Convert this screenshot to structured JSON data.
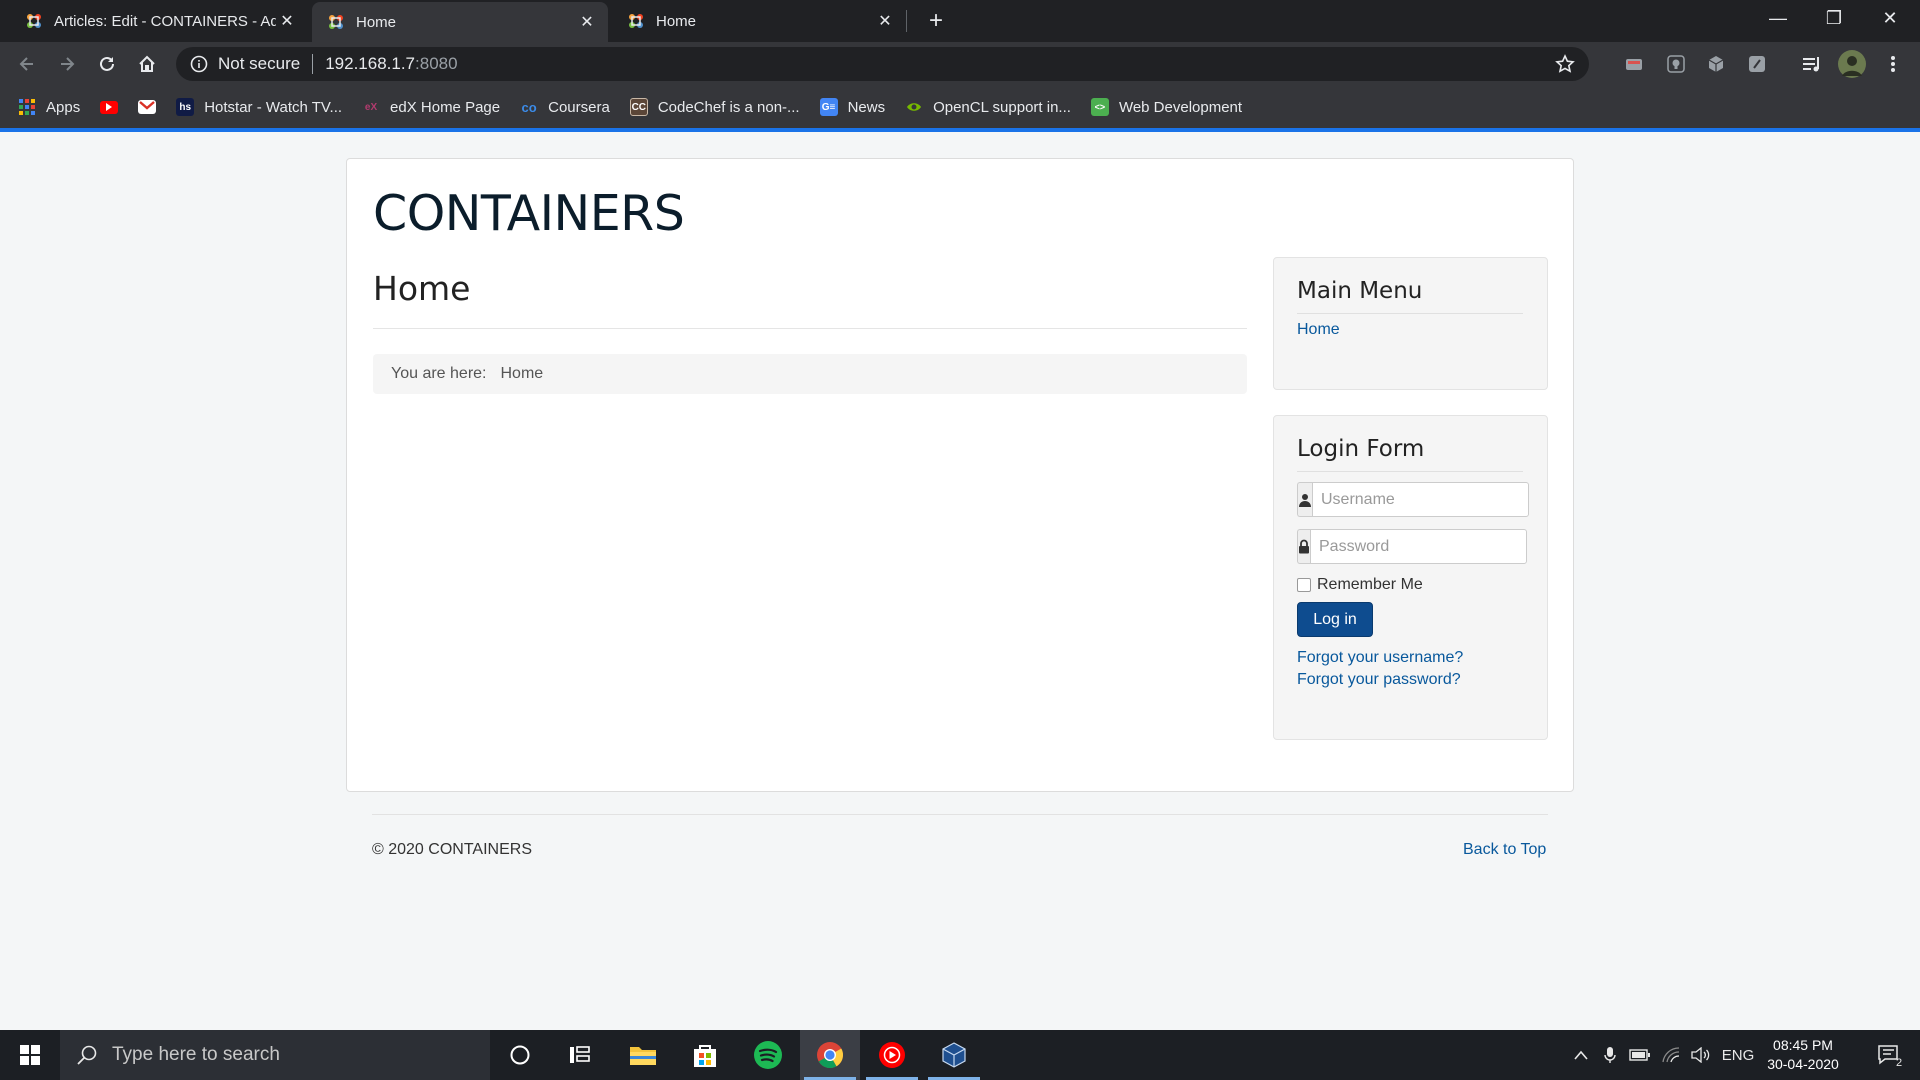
{
  "browser": {
    "tabs": [
      {
        "title": "Articles: Edit - CONTAINERS - Ad",
        "close": "✕"
      },
      {
        "title": "Home",
        "close": "✕"
      },
      {
        "title": "Home",
        "close": "✕"
      }
    ],
    "new_tab": "+",
    "window_controls": {
      "minimize": "—",
      "restore": "❐",
      "close": "✕"
    },
    "address": {
      "security": "Not secure",
      "host": "192.168.1.7",
      "port": ":8080"
    },
    "bookmarks": [
      {
        "label": "Apps",
        "icon": "apps-grid-icon"
      },
      {
        "label": "",
        "icon": "youtube-icon"
      },
      {
        "label": "",
        "icon": "gmail-icon"
      },
      {
        "label": "Hotstar - Watch TV...",
        "icon": "hotstar-icon",
        "icon_text": "hs"
      },
      {
        "label": "edX Home Page",
        "icon": "edx-icon",
        "icon_text": "eX"
      },
      {
        "label": "Coursera",
        "icon": "coursera-icon",
        "icon_text": "co"
      },
      {
        "label": "CodeChef is a non-...",
        "icon": "codechef-icon",
        "icon_text": "CC"
      },
      {
        "label": "News",
        "icon": "google-news-icon",
        "icon_text": "G≡"
      },
      {
        "label": "OpenCL support in...",
        "icon": "nvidia-icon",
        "icon_text": ""
      },
      {
        "label": "Web Development",
        "icon": "web-dev-icon",
        "icon_text": "<>"
      }
    ]
  },
  "site": {
    "brand": "CONTAINERS",
    "page_title": "Home",
    "breadcrumb": {
      "prefix": "You are here:",
      "current": "Home"
    },
    "main_menu": {
      "title": "Main Menu",
      "items": [
        "Home"
      ]
    },
    "login": {
      "title": "Login Form",
      "username_placeholder": "Username",
      "password_placeholder": "Password",
      "remember": "Remember Me",
      "submit": "Log in",
      "forgot_username": "Forgot your username?",
      "forgot_password": "Forgot your password?"
    },
    "footer": {
      "copyright": "© 2020 CONTAINERS",
      "back_to_top": "Back to Top"
    }
  },
  "taskbar": {
    "search_placeholder": "Type here to search",
    "language": "ENG",
    "time": "08:45 PM",
    "date": "30-04-2020",
    "notifications": "2"
  },
  "colors": {
    "accent": "#1a73e8",
    "link": "#08589c",
    "button": "#0e4c8f"
  }
}
